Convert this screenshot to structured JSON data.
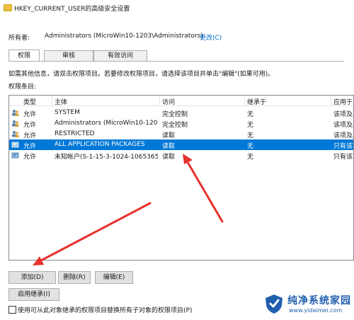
{
  "window": {
    "title": "HKEY_CURRENT_USER的高级安全设置"
  },
  "owner": {
    "label": "所有者:",
    "value": "Administrators (MicroWin10-1203\\Administrators)",
    "change_link": "更改(C)"
  },
  "tabs": [
    {
      "label": "权限",
      "active": true
    },
    {
      "label": "审核",
      "active": false
    },
    {
      "label": "有效访问",
      "active": false
    }
  ],
  "info_text": "如需其他信息，请双击权限项目。若要修改权限项目，请选择该项目并单击\"编辑\"(如果可用)。",
  "entries_label": "权限条目:",
  "table": {
    "headers": [
      "类型",
      "主体",
      "访问",
      "继承于",
      "应用于"
    ],
    "rows": [
      {
        "type": "允许",
        "principal": "SYSTEM",
        "access": "完全控制",
        "inherited": "无",
        "applies": "该项及其",
        "icon": "user-group-icon",
        "selected": false
      },
      {
        "type": "允许",
        "principal": "Administrators (MicroWin10-120...",
        "access": "完全控制",
        "inherited": "无",
        "applies": "该项及其",
        "icon": "user-group-icon",
        "selected": false
      },
      {
        "type": "允许",
        "principal": "RESTRICTED",
        "access": "读取",
        "inherited": "无",
        "applies": "该项及其",
        "icon": "user-group-icon",
        "selected": false
      },
      {
        "type": "允许",
        "principal": "ALL APPLICATION PACKAGES",
        "access": "读取",
        "inherited": "无",
        "applies": "只有该项",
        "icon": "package-icon",
        "selected": true
      },
      {
        "type": "允许",
        "principal": "未知帐户(S-1-15-3-1024-1065365...",
        "access": "读取",
        "inherited": "无",
        "applies": "只有该项",
        "icon": "package-icon",
        "selected": false
      }
    ]
  },
  "buttons": {
    "add": "添加(D)",
    "remove": "删除(R)",
    "edit": "编辑(E)",
    "enable_inheritance": "启用继承(I)"
  },
  "checkbox": {
    "label": "使用可从此对象继承的权限项目替换所有子对象的权限项目(P)",
    "checked": false
  },
  "watermark": {
    "title": "纯净系统家园",
    "url": "www.yidaimei.com"
  },
  "colors": {
    "selection": "#0078d7",
    "link": "#0066cc",
    "annotation_arrow": "#e8322e",
    "watermark": "#1f5fae"
  }
}
